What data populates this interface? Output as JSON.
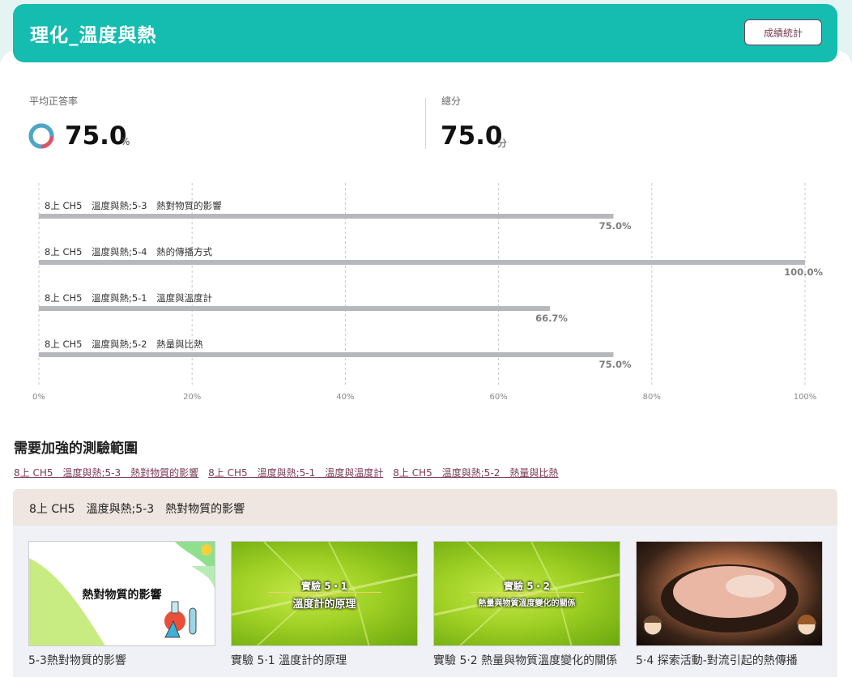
{
  "header": {
    "title": "理化_溫度與熱",
    "stats_button": "成績統計"
  },
  "metrics": {
    "avg_label": "平均正答率",
    "avg_value": "75.0",
    "avg_unit": "%",
    "avg_fraction": 0.75,
    "total_label": "總分",
    "total_value": "75.0",
    "total_unit": "分"
  },
  "chart_data": {
    "type": "bar",
    "orientation": "horizontal",
    "categories": [
      "8上 CH5　溫度與熱;5-3　熱對物質的影響",
      "8上 CH5　溫度與熱;5-4　熱的傳播方式",
      "8上 CH5　溫度與熱;5-1　溫度與溫度計",
      "8上 CH5　溫度與熱;5-2　熱量與比熱"
    ],
    "values": [
      75.0,
      100.0,
      66.7,
      75.0
    ],
    "value_labels": [
      "75.0%",
      "100.0%",
      "66.7%",
      "75.0%"
    ],
    "x_ticks": [
      "0%",
      "20%",
      "40%",
      "60%",
      "80%",
      "100%"
    ],
    "xlim": [
      0,
      100
    ],
    "grid": "vertical dashed",
    "bar_color": "#b7b8bd",
    "label_color": "#7d7d7d"
  },
  "weak": {
    "title": "需要加強的測驗範圍",
    "links": [
      "8上 CH5　溫度與熱;5-3　熱對物質的影響",
      "8上 CH5　溫度與熱;5-1　溫度與溫度計",
      "8上 CH5　溫度與熱;5-2　熱量與比熱"
    ]
  },
  "lesson": {
    "header": "8上 CH5　溫度與熱;5-3　熱對物質的影響",
    "cards": [
      {
        "title": "5-3熱對物質的影響",
        "caption": "熱對物質的影響"
      },
      {
        "title": "實驗 5·1 溫度計的原理",
        "caption_top": "實驗 5・1",
        "caption_bottom": "溫度計的原理"
      },
      {
        "title": "實驗 5·2 熱量與物質溫度變化的關係",
        "caption_top": "實驗 5・2",
        "caption_bottom": "熱量與物質溫度變化的關係"
      },
      {
        "title": "5·4 探索活動-對流引起的熱傳播",
        "caption": ""
      }
    ]
  },
  "colors": {
    "header_bg": "#15bcb0",
    "accent": "#7a3a55",
    "donut_main": "#4aa7c6",
    "donut_rest": "#d8566b"
  }
}
